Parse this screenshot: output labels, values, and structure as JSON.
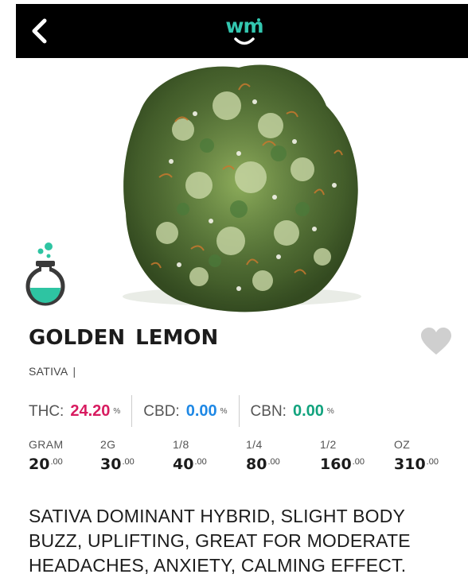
{
  "header": {
    "back_icon": "chevron-left-icon",
    "logo_text": "wm",
    "background": "#000000",
    "logo_color": "#33c7b0"
  },
  "product": {
    "image": "cannabis-bud-photo",
    "badge_icon": "lab-flask-icon",
    "name": "GOLDEN  LEMON",
    "favorite_icon": "heart-icon",
    "strain": "SATIVA",
    "strain_separator": "|"
  },
  "cannabinoids": [
    {
      "label": "THC:",
      "value": "24.20",
      "unit": "%",
      "color": "#d81b60"
    },
    {
      "label": "CBD:",
      "value": "0.00",
      "unit": "%",
      "color": "#1e88e5"
    },
    {
      "label": "CBN:",
      "value": "0.00",
      "unit": "%",
      "color": "#12a37e"
    }
  ],
  "prices": [
    {
      "unit": "GRAM",
      "whole": "20",
      "cents": ".00"
    },
    {
      "unit": "2G",
      "whole": "30",
      "cents": ".00"
    },
    {
      "unit": "1/8",
      "whole": "40",
      "cents": ".00"
    },
    {
      "unit": "1/4",
      "whole": "80",
      "cents": ".00"
    },
    {
      "unit": "1/2",
      "whole": "160",
      "cents": ".00"
    },
    {
      "unit": "OZ",
      "whole": "310",
      "cents": ".00"
    }
  ],
  "description": "SATIVA DOMINANT HYBRID, SLIGHT BODY BUZZ, UPLIFTING, GREAT FOR MODERATE HEADACHES, ANXIETY, CALMING EFFECT."
}
